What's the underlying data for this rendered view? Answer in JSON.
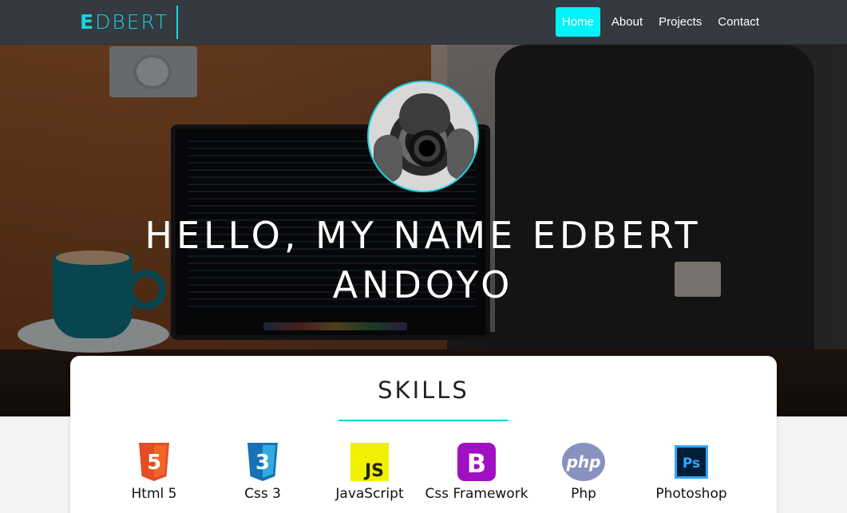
{
  "brand": {
    "first_letter": "E",
    "rest": "DBERT"
  },
  "nav": {
    "items": [
      {
        "label": "Home",
        "active": true
      },
      {
        "label": "About",
        "active": false
      },
      {
        "label": "Projects",
        "active": false
      },
      {
        "label": "Contact",
        "active": false
      }
    ]
  },
  "hero": {
    "title_line1": "HELLO, MY NAME EDBERT",
    "title_line2": "ANDOYO"
  },
  "skills": {
    "title": "SKILLS",
    "items": [
      {
        "label": "Html 5",
        "icon": "html5-icon",
        "icon_text": "5",
        "color": "#e44d26"
      },
      {
        "label": "Css 3",
        "icon": "css3-icon",
        "icon_text": "3",
        "color": "#1572b6"
      },
      {
        "label": "JavaScript",
        "icon": "javascript-icon",
        "icon_text": "JS",
        "color": "#f0db4f"
      },
      {
        "label": "Css Framework",
        "icon": "bootstrap-icon",
        "icon_text": "B",
        "color": "#7e13c9"
      },
      {
        "label": "Php",
        "icon": "php-icon",
        "icon_text": "php",
        "color": "#8892bf"
      },
      {
        "label": "Photoshop",
        "icon": "photoshop-icon",
        "icon_text": "Ps",
        "color": "#31a8ff"
      }
    ]
  },
  "colors": {
    "accent": "#18d3e0",
    "nav_bg": "#343a40",
    "active_nav": "#00f3f8"
  }
}
